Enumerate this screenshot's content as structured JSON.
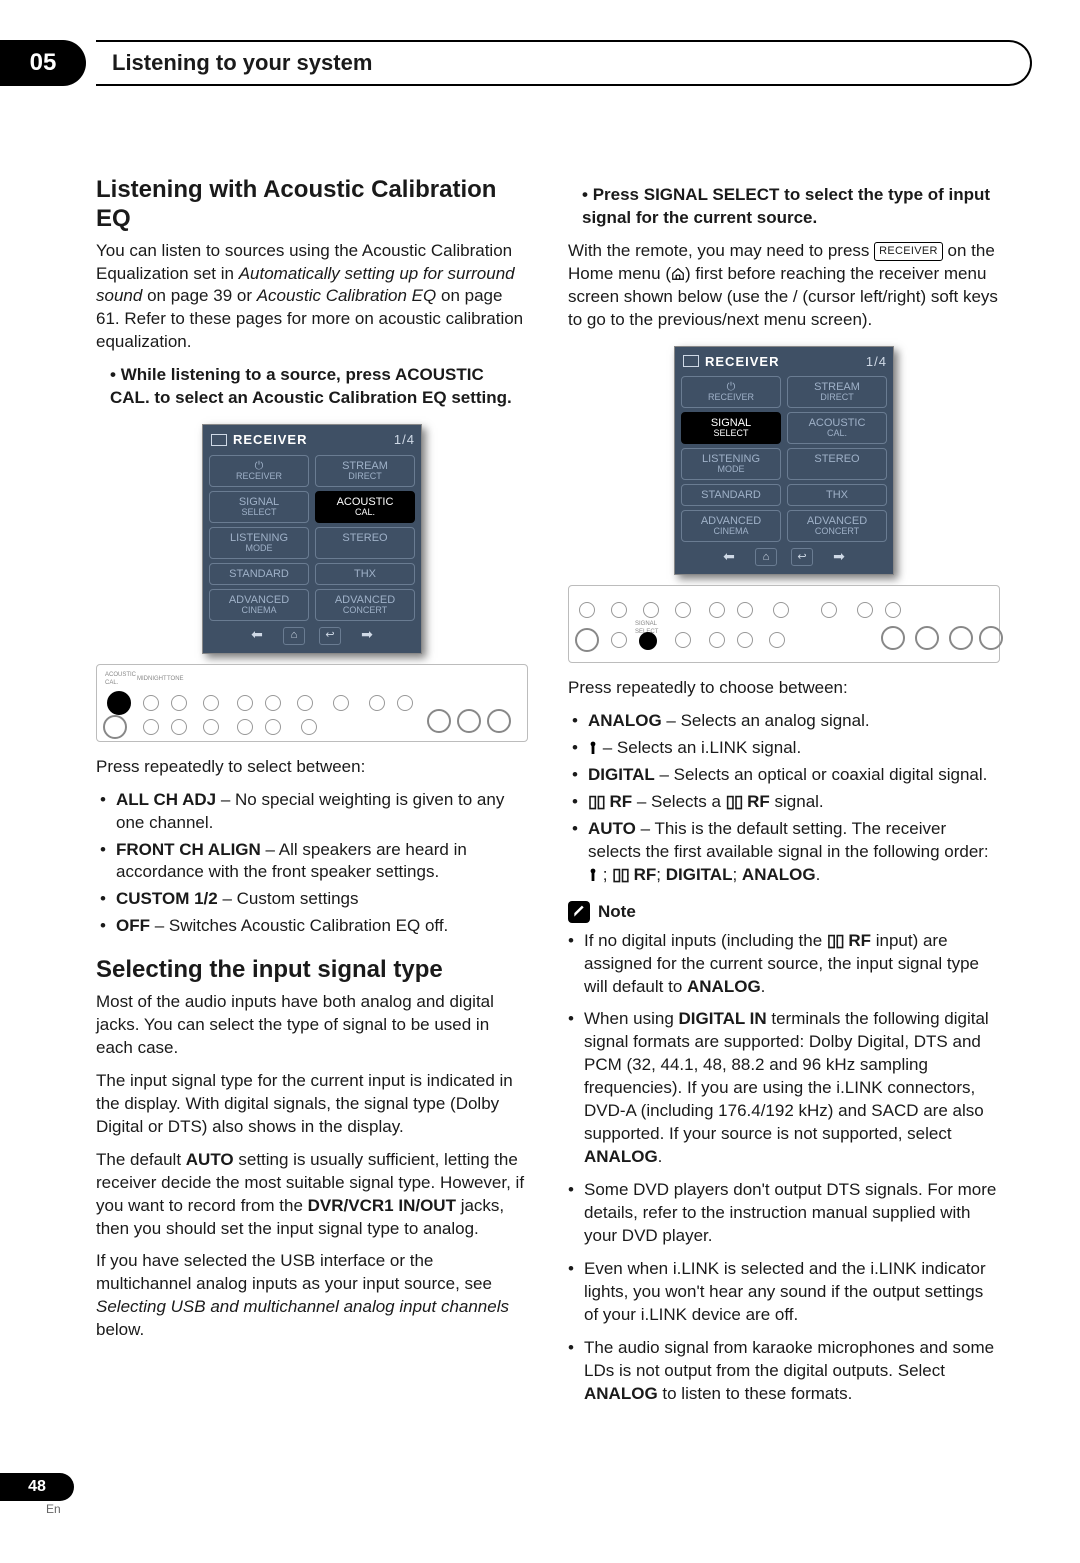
{
  "chapter": {
    "num": "05",
    "title": "Listening to your system"
  },
  "page": {
    "num": "48",
    "lang": "En"
  },
  "left": {
    "h1": "Listening with Acoustic Calibration EQ",
    "p1_a": "You can listen to sources using the Acoustic Calibration Equalization set in ",
    "p1_it1": "Automatically setting up for surround sound",
    "p1_b": " on page 39 or ",
    "p1_it2": "Acoustic Calibration EQ",
    "p1_c": " on page 61. Refer to these pages for more on acoustic calibration equalization.",
    "instr": "While listening to a source, press ACOUSTIC CAL. to select an Acoustic Calibration EQ setting.",
    "press": "Press repeatedly to select between:",
    "items": [
      {
        "b": "ALL CH ADJ",
        "t": " – No special weighting is given to any one channel."
      },
      {
        "b": "FRONT CH ALIGN",
        "t": " – All speakers are heard in accordance with the front speaker settings."
      },
      {
        "b": "CUSTOM 1/2",
        "t": " – Custom settings"
      },
      {
        "b": "OFF",
        "t": " – Switches Acoustic Calibration EQ off."
      }
    ],
    "h2": "Selecting the input signal type",
    "p2": "Most of the audio inputs have both analog and digital jacks. You can select the type of signal to be used in each case.",
    "p3": "The input signal type for the current input is indicated in the display. With digital signals, the signal type (Dolby Digital or DTS) also shows in the display.",
    "p4_a": "The default ",
    "p4_b": "AUTO",
    "p4_c": " setting is usually sufficient, letting the receiver decide the most suitable signal type. However, if you want to record from the ",
    "p4_d": "DVR/VCR1 IN/OUT",
    "p4_e": " jacks, then you should set the input signal type to analog.",
    "p5_a": "If you have selected the USB interface or the multichannel analog inputs as your input source, see ",
    "p5_it": "Selecting USB and multichannel analog input channels",
    "p5_b": " below."
  },
  "right": {
    "instr": "Press SIGNAL SELECT to select the type of input signal for the current source.",
    "p1_a": "With the remote, you may need to press ",
    "p1_btn": "RECEIVER",
    "p1_b": " on the Home menu (",
    "p1_c": ") first before reaching the receiver menu screen shown below (use the ",
    "p1_keys": " / ",
    "p1_d": " (cursor left/right) soft keys to go to the previous/next menu screen).",
    "press": "Press repeatedly to choose between:",
    "items": [
      {
        "b": "ANALOG",
        "t": " – Selects an analog signal."
      },
      {
        "pre": " – Selects an i.LINK signal.",
        "icon": "ilink"
      },
      {
        "b": "DIGITAL",
        "t": " – Selects an optical or coaxial digital signal."
      },
      {
        "dd": true,
        "b": " RF",
        "t": " – Selects a ",
        "dd2": true,
        "t2": " RF",
        " t3": " signal."
      },
      {
        "b": "AUTO",
        "t": " – This is the default setting. The receiver selects the first available signal in the following order: ",
        "order": true
      }
    ],
    "order_labels": {
      "rf": " RF",
      "dig": "DIGITAL",
      "ana": "ANALOG"
    },
    "noteTitle": "Note",
    "notes": [
      {
        "a": "If no digital inputs (including the ",
        "dd": true,
        "mid": " RF",
        "b": " input) are assigned for the current source, the input signal type will default to ",
        "c": "ANALOG",
        "d": "."
      },
      {
        "a": "When using ",
        "b": "DIGITAL IN",
        "c": " terminals the following digital signal formats are supported: Dolby Digital, DTS and PCM (32, 44.1, 48, 88.2 and 96 kHz sampling frequencies). If you are using the i.LINK connectors, DVD-A (including 176.4/192 kHz) and SACD are also supported. If your source is not supported, select ",
        "d": "ANALOG",
        "e": "."
      },
      {
        "a": "Some DVD players don't output DTS signals. For more details, refer to the instruction manual supplied with your DVD player."
      },
      {
        "a": "Even when i.LINK is selected and the i.LINK indicator lights, you won't hear any sound if the output settings of your i.LINK device are off."
      },
      {
        "a": "The audio signal from karaoke microphones and some LDs is not output from the digital outputs. Select ",
        "b": "ANALOG",
        "c": " to listen to these formats."
      }
    ]
  },
  "rc": {
    "title": "RECEIVER",
    "frac": "1/4",
    "cells": [
      [
        "⏻ RECEIVER",
        "STREAM DIRECT"
      ],
      [
        "SIGNAL SELECT",
        "ACOUSTIC CAL."
      ],
      [
        "LISTENING MODE",
        "STEREO"
      ],
      [
        "STANDARD",
        "THX"
      ],
      [
        "ADVANCED CINEMA",
        "ADVANCED CONCERT"
      ]
    ],
    "left_hi": 3,
    "right_hi": 1
  }
}
